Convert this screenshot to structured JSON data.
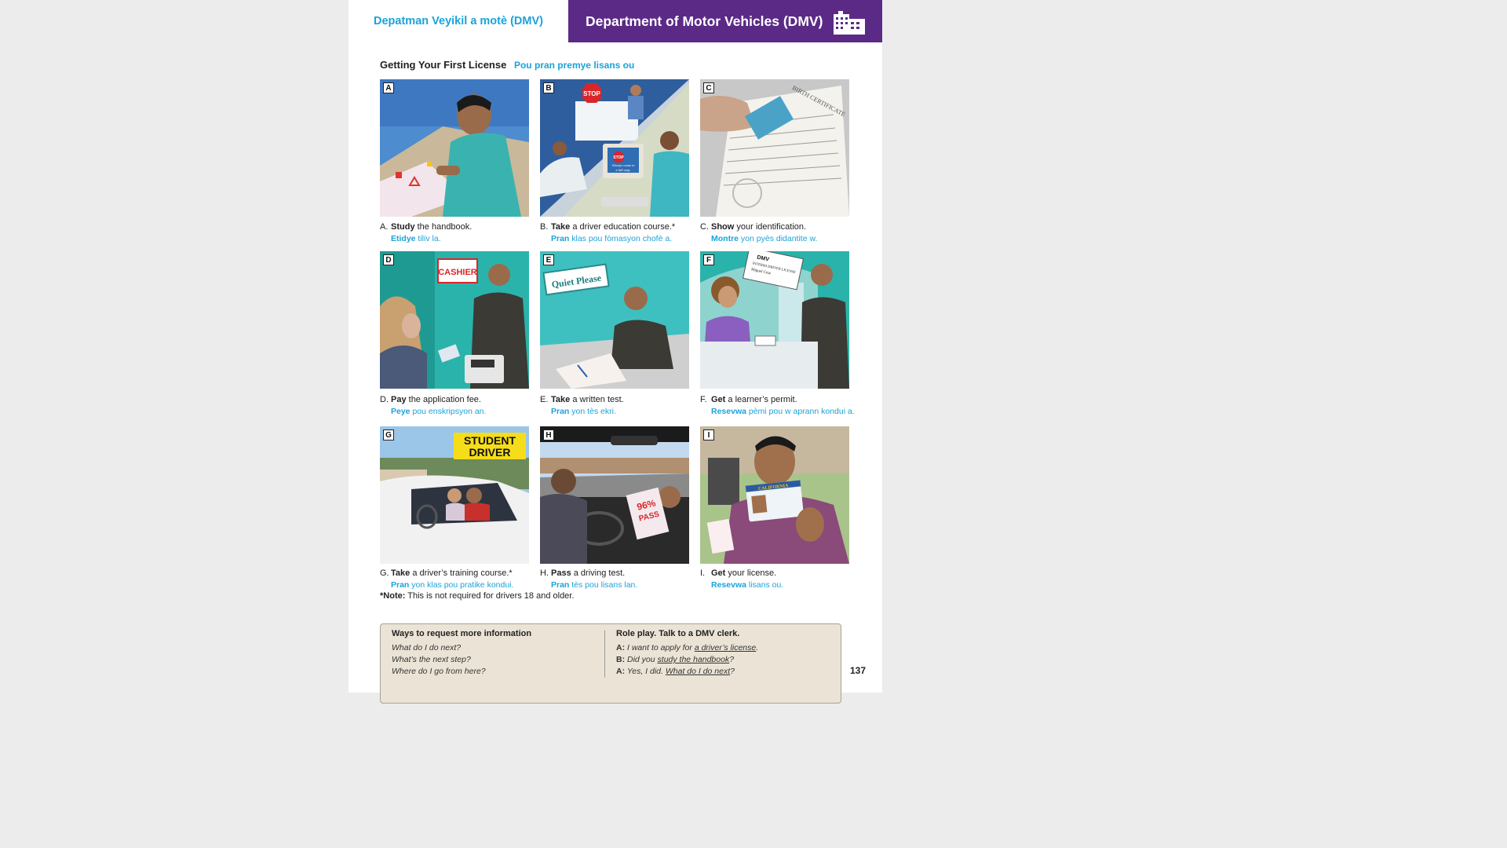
{
  "header": {
    "left_title": "Depatman Veyikil a motè (DMV)",
    "right_title": "Department of Motor Vehicles (DMV)"
  },
  "section": {
    "title": "Getting Your First License",
    "title_translation": "Pou pran premye lisans ou"
  },
  "steps": [
    {
      "letter": "A",
      "marker": "A.",
      "verb": "Study",
      "rest": " the handbook.",
      "verb_ht": "Etidye",
      "rest_ht": " tiliv la."
    },
    {
      "letter": "B",
      "marker": "B.",
      "verb": "Take",
      "rest": " a driver education course.*",
      "verb_ht": "Pran",
      "rest_ht": " klas pou fòmasyon chofè a."
    },
    {
      "letter": "C",
      "marker": "C.",
      "verb": "Show",
      "rest": " your identification.",
      "verb_ht": "Montre",
      "rest_ht": " yon pyès didantite w."
    },
    {
      "letter": "D",
      "marker": "D.",
      "verb": "Pay",
      "rest": " the application fee.",
      "verb_ht": "Peye",
      "rest_ht": " pou enskripsyon an."
    },
    {
      "letter": "E",
      "marker": "E.",
      "verb": "Take",
      "rest": " a written test.",
      "verb_ht": "Pran",
      "rest_ht": " yon tès ekri."
    },
    {
      "letter": "F",
      "marker": "F.",
      "verb": "Get",
      "rest": " a learner’s permit.",
      "verb_ht": "Resevwa",
      "rest_ht": " pèmi pou w aprann kondui a."
    },
    {
      "letter": "G",
      "marker": "G.",
      "verb": "Take",
      "rest": " a driver’s training course.*",
      "verb_ht": "Pran",
      "rest_ht": " yon klas pou pratike kondui."
    },
    {
      "letter": "H",
      "marker": "H.",
      "verb": "Pass",
      "rest": " a driving test.",
      "verb_ht": "Pran",
      "rest_ht": " tès pou lisans lan."
    },
    {
      "letter": "I",
      "marker": "I.",
      "verb": "Get",
      "rest": " your license.",
      "verb_ht": "Resevwa",
      "rest_ht": " lisans ou."
    }
  ],
  "illustration_text": {
    "stop": "STOP",
    "monitor_line1": "Always come to",
    "monitor_line2": "a full stop.",
    "birth_cert": "BIRTH CERTIFICATE",
    "cashier": "CASHIER",
    "quiet": "Quiet Please",
    "dmv": "DMV",
    "permit_title": "INTERIM DRIVER LICENSE",
    "permit_name": "Miguel Cruz",
    "student_driver_1": "STUDENT",
    "student_driver_2": "DRIVER",
    "pass_pct": "96%",
    "pass_word": "PASS",
    "license_state": "CALIFORNIA"
  },
  "note": {
    "label": "*Note:",
    "text": " This is not required for drivers 18 and older."
  },
  "info_box": {
    "ways_title": "Ways to request more information",
    "ways": [
      "What do I do next?",
      "What’s the next step?",
      "Where do I go from here?"
    ],
    "role_title": "Role play. Talk to a DMV clerk.",
    "role": [
      {
        "speaker": "A:",
        "pre": " I want to apply for ",
        "u": "a driver’s license",
        "post": "."
      },
      {
        "speaker": "B:",
        "pre": " Did you ",
        "u": "study the handbook",
        "post": "?"
      },
      {
        "speaker": "A:",
        "pre": " Yes, I did. ",
        "u": "What do I do next",
        "post": "?"
      }
    ]
  },
  "page_number": "137",
  "colors": {
    "accent_blue": "#1aa3d9",
    "header_purple": "#5b2a86",
    "box_bg": "#ebe4d6"
  }
}
